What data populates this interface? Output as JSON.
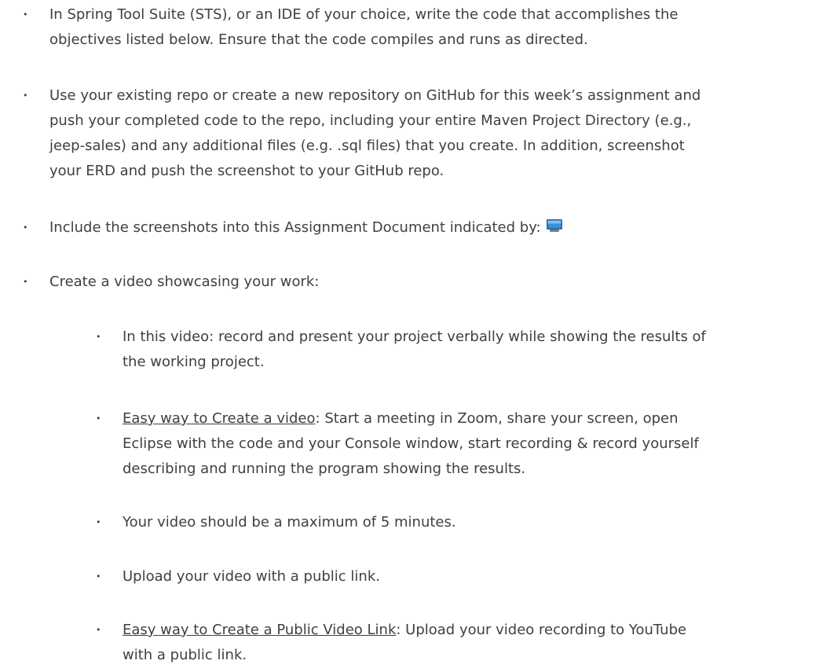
{
  "bullet_glyph": "•",
  "items": {
    "i1": {
      "l1": "In Spring Tool Suite (STS), or an IDE of your choice, write the code that accomplishes the",
      "l2": "objectives listed below. Ensure that the code compiles and runs as directed."
    },
    "i2": {
      "l1": "Use your existing repo or create a new repository on GitHub for this week’s assignment and",
      "l2": "push your completed code to the repo, including your entire Maven Project Directory (e.g.,",
      "l3": "jeep-sales) and any additional files (e.g. .sql files) that you create.  In addition, screenshot",
      "l4": "your ERD and push the screenshot to your GitHub repo."
    },
    "i3": {
      "l1": "Include the screenshots into this Assignment Document indicated by:",
      "icon": "monitor-icon"
    },
    "i4": {
      "l1": "Create a video showcasing your work:"
    },
    "s1": {
      "l1": "In this video: record and present your project verbally while showing the results of",
      "l2": "the working project."
    },
    "s2": {
      "link": "Easy way to Create a video",
      "l1_rest": ":  Start a meeting in Zoom, share your screen, open",
      "l2": "Eclipse with the code and your Console window, start recording & record yourself",
      "l3": "describing and running the program showing the results."
    },
    "s3": {
      "l1": "Your video should be a maximum of 5 minutes."
    },
    "s4": {
      "l1": "Upload your video with a public link."
    },
    "s5": {
      "link": "Easy way to Create a Public Video Link",
      "l1_rest": ":  Upload your video recording to YouTube",
      "l2": "with a public link."
    }
  },
  "colors": {
    "text": "#404040",
    "monitor_screen": "#3a8fd8",
    "monitor_frame": "#2b5f9e"
  }
}
